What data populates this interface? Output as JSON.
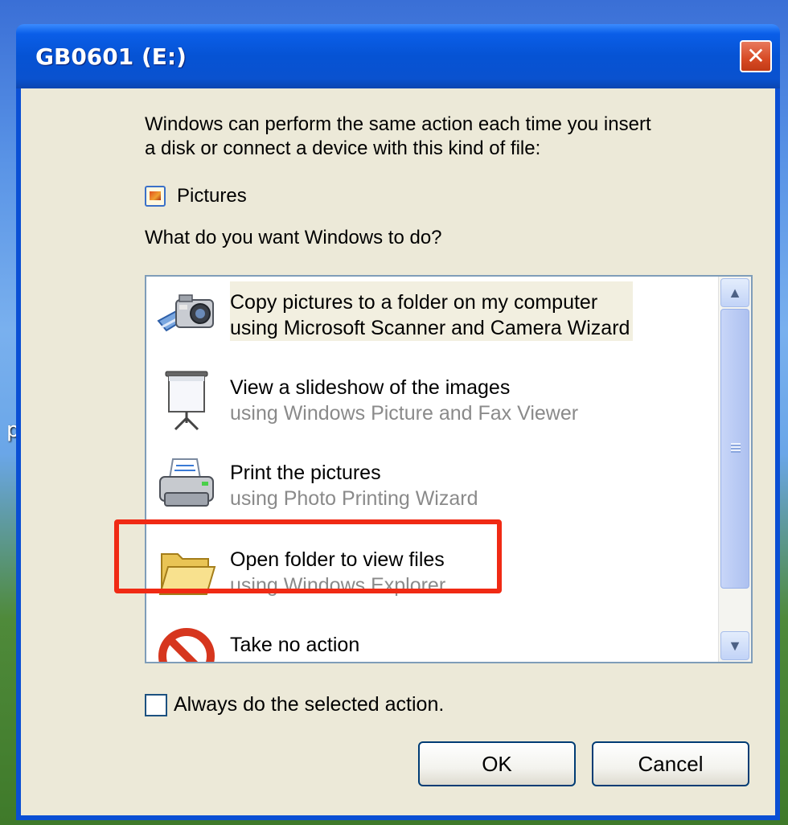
{
  "desktop": {
    "fragment_text": "pd"
  },
  "window": {
    "title": "GB0601 (E:)",
    "close_glyph": "✕"
  },
  "dialog": {
    "intro_line1": "Windows can perform the same action each time you insert",
    "intro_line2": "a disk or connect a device with this kind of file:",
    "content_type_icon": "pictures-icon",
    "content_type_label": "Pictures",
    "question": "What do you want Windows to do?",
    "actions": [
      {
        "icon": "camera-icon",
        "title": "Copy pictures to a folder on my computer",
        "subtitle": "using Microsoft Scanner and Camera Wizard",
        "selected": true
      },
      {
        "icon": "projector-screen-icon",
        "title": "View a slideshow of the images",
        "subtitle": "using Windows Picture and Fax Viewer"
      },
      {
        "icon": "printer-icon",
        "title": "Print the pictures",
        "subtitle": "using Photo Printing Wizard"
      },
      {
        "icon": "folder-icon",
        "title": "Open folder to view files",
        "subtitle": "using Windows Explorer",
        "highlighted": true
      },
      {
        "icon": "no-action-icon",
        "title": "Take no action",
        "subtitle": ""
      }
    ],
    "always_label": "Always do the selected action.",
    "always_checked": false,
    "ok_label": "OK",
    "cancel_label": "Cancel"
  },
  "colors": {
    "highlight_border": "#f02a14",
    "title_bar": "#0653d4",
    "dialog_bg": "#ece9d8"
  }
}
